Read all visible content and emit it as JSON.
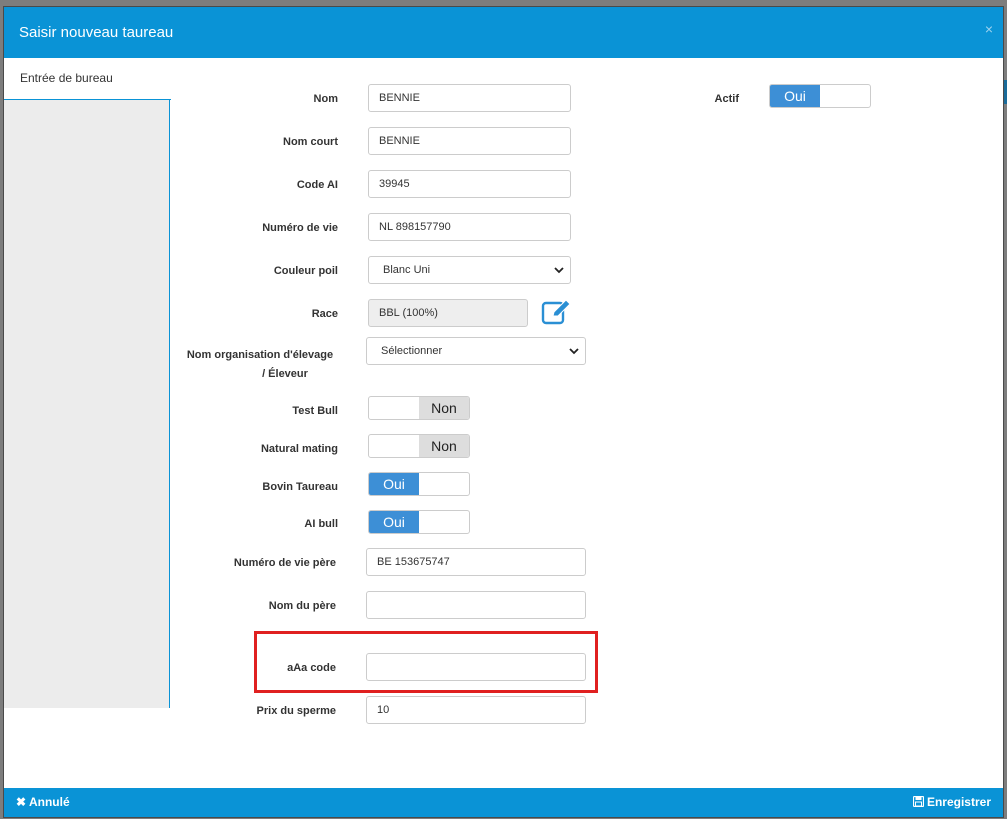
{
  "modal": {
    "title": "Saisir nouveau taureau",
    "close_label": "×",
    "sidebar_tab": "Entrée de bureau"
  },
  "form": {
    "nom": {
      "label": "Nom",
      "value": "BENNIE"
    },
    "nom_court": {
      "label": "Nom court",
      "value": "BENNIE"
    },
    "code_ai": {
      "label": "Code AI",
      "value": "39945"
    },
    "numero_vie": {
      "label": "Numéro de vie",
      "value": "NL 898157790"
    },
    "couleur_poil": {
      "label": "Couleur poil",
      "value": "Blanc Uni"
    },
    "race": {
      "label": "Race",
      "value": "BBL (100%)"
    },
    "organisation": {
      "label_1": "Nom organisation d'élevage",
      "label_2": "/ Éleveur",
      "value": "Sélectionner"
    },
    "test_bull": {
      "label": "Test Bull",
      "value": "Non"
    },
    "natural_mating": {
      "label": "Natural mating",
      "value": "Non"
    },
    "bovin_taureau": {
      "label": "Bovin Taureau",
      "value": "Oui"
    },
    "ai_bull": {
      "label": "AI bull",
      "value": "Oui"
    },
    "numero_vie_pere": {
      "label": "Numéro de vie père",
      "value": "BE 153675747"
    },
    "nom_pere": {
      "label": "Nom du père",
      "value": ""
    },
    "aaa_code": {
      "label": "aAa code",
      "value": ""
    },
    "prix_sperme": {
      "label": "Prix du sperme",
      "value": "10"
    },
    "actif": {
      "label": "Actif",
      "value": "Oui"
    }
  },
  "footer": {
    "cancel_label": "Annulé",
    "save_label": "Enregistrer"
  },
  "colors": {
    "header": "#0a93d6",
    "toggle_on": "#3d8fd6",
    "highlight": "#e02020"
  }
}
